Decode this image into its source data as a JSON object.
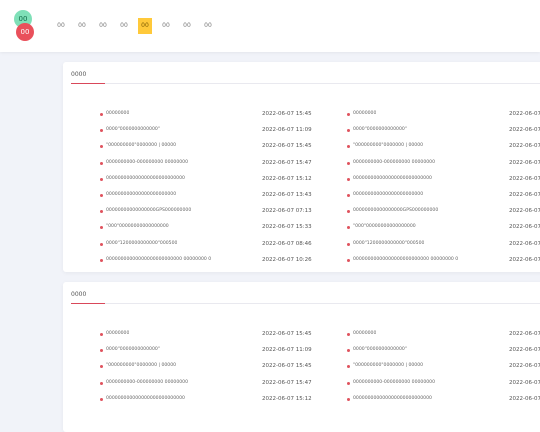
{
  "logo": {
    "top_text": "00",
    "bottom_text": "00"
  },
  "nav": {
    "items": [
      {
        "label": "00",
        "active": false
      },
      {
        "label": "00",
        "active": false
      },
      {
        "label": "00",
        "active": false
      },
      {
        "label": "00",
        "active": false
      },
      {
        "label": "00",
        "active": true
      },
      {
        "label": "00",
        "active": false
      },
      {
        "label": "00",
        "active": false
      },
      {
        "label": "00",
        "active": false
      }
    ]
  },
  "sections": [
    {
      "title": "0000",
      "left": [
        {
          "title": "00000000",
          "date": "2022-06-07 15:45"
        },
        {
          "title": "0000\"0000000000000\"",
          "date": "2022-06-07 11:09"
        },
        {
          "title": "\"000000000\"0000000 | 00000",
          "date": "2022-06-07 15:45"
        },
        {
          "title": "0000000000-000000000 00000000",
          "date": "2022-06-07 15:47"
        },
        {
          "title": "000000000000000000000000000",
          "date": "2022-06-07 15:12"
        },
        {
          "title": "000000000000000000000000",
          "date": "2022-06-07 13:43"
        },
        {
          "title": "00000000000000000GPS000000000",
          "date": "2022-06-07 07:13"
        },
        {
          "title": "\"000\"00000000000000000",
          "date": "2022-06-07 15:33"
        },
        {
          "title": "0000\"1200000000000\"000500",
          "date": "2022-06-07 08:46"
        },
        {
          "title": "00000000000000000000000000 00000000 0",
          "date": "2022-06-07 10:26"
        }
      ],
      "right": [
        {
          "title": "00000000",
          "date": "2022-06-07"
        },
        {
          "title": "0000\"0000000000000\"",
          "date": "2022-06-07"
        },
        {
          "title": "\"000000000\"0000000 | 00000",
          "date": "2022-06-07"
        },
        {
          "title": "0000000000-000000000 00000000",
          "date": "2022-06-07"
        },
        {
          "title": "000000000000000000000000000",
          "date": "2022-06-07"
        },
        {
          "title": "000000000000000000000000",
          "date": "2022-06-07"
        },
        {
          "title": "00000000000000000GPS000000000",
          "date": "2022-06-07"
        },
        {
          "title": "\"000\"00000000000000000",
          "date": "2022-06-07"
        },
        {
          "title": "0000\"1200000000000\"000500",
          "date": "2022-06-07"
        },
        {
          "title": "00000000000000000000000000 00000000 0",
          "date": "2022-06-07"
        }
      ]
    },
    {
      "title": "0000",
      "left": [
        {
          "title": "00000000",
          "date": "2022-06-07 15:45"
        },
        {
          "title": "0000\"0000000000000\"",
          "date": "2022-06-07 11:09"
        },
        {
          "title": "\"000000000\"0000000 | 00000",
          "date": "2022-06-07 15:45"
        },
        {
          "title": "0000000000-000000000 00000000",
          "date": "2022-06-07 15:47"
        },
        {
          "title": "000000000000000000000000000",
          "date": "2022-06-07 15:12"
        }
      ],
      "right": [
        {
          "title": "00000000",
          "date": "2022-06-07"
        },
        {
          "title": "0000\"0000000000000\"",
          "date": "2022-06-07"
        },
        {
          "title": "\"000000000\"0000000 | 00000",
          "date": "2022-06-07"
        },
        {
          "title": "0000000000-000000000 00000000",
          "date": "2022-06-07"
        },
        {
          "title": "000000000000000000000000000",
          "date": "2022-06-07"
        }
      ]
    }
  ],
  "colors": {
    "accent": "#ffc93a",
    "bullet": "#e0535e",
    "underline": "#d9485a",
    "background": "#f1f3f9"
  }
}
